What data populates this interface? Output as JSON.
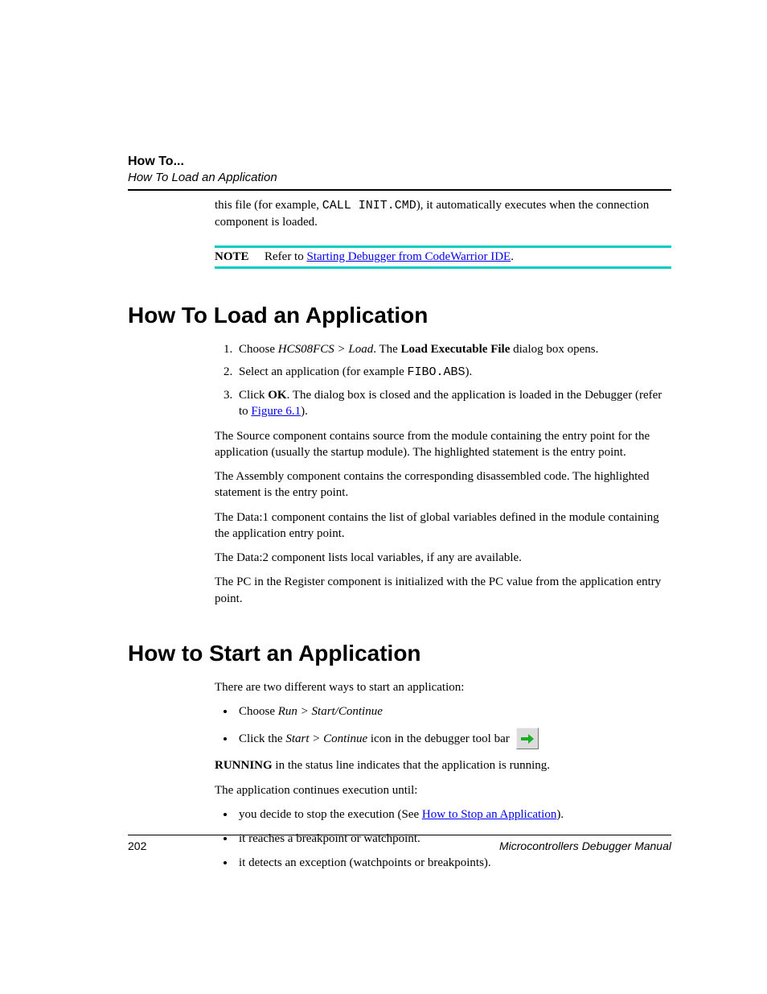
{
  "header": {
    "title": "How To...",
    "subtitle": "How To Load an Application"
  },
  "intro_para": {
    "prefix": "this file (for example, ",
    "code": "CALL INIT.CMD",
    "suffix": "), it automatically executes when the connection component is loaded."
  },
  "note": {
    "label": "NOTE",
    "prefix": "Refer to ",
    "link": "Starting Debugger from CodeWarrior IDE",
    "suffix": "."
  },
  "section1": {
    "heading": "How To Load an Application",
    "steps": [
      {
        "pre": "Choose ",
        "italic": "HCS08FCS > Load",
        "mid": ". The ",
        "bold": "Load Executable File",
        "post": " dialog box opens."
      },
      {
        "pre": "Select an application (for example ",
        "code": "FIBO.ABS",
        "post": ")."
      },
      {
        "pre": "Click ",
        "bold": "OK",
        "mid": ". The dialog box is closed and the application is loaded in the Debugger (refer to ",
        "link": "Figure 6.1",
        "post": ")."
      }
    ],
    "paragraphs": [
      "The Source component contains source from the module containing the entry point for the application (usually the startup module). The highlighted statement is the entry point.",
      "The Assembly component contains the corresponding disassembled code. The highlighted statement is the entry point.",
      "The Data:1 component contains the list of global variables defined in the module containing the application entry point.",
      "The Data:2 component lists local variables, if any are available.",
      "The PC in the Register component is initialized with the PC value from the application entry point."
    ]
  },
  "section2": {
    "heading": "How to Start an Application",
    "intro": "There are two different ways to start an application:",
    "bullets1": [
      {
        "pre": "Choose ",
        "italic": "Run > Start/Continue"
      },
      {
        "pre": "Click the ",
        "italic": "Start > Continue",
        "post": " icon in the debugger tool bar",
        "icon": true
      }
    ],
    "running_line": {
      "bold": "RUNNING",
      "rest": " in the status line indicates that the application is running."
    },
    "continue_intro": "The application continues execution until:",
    "bullets2": [
      {
        "pre": "you decide to stop the execution (See ",
        "link": "How to Stop an Application",
        "post": ")."
      },
      {
        "text": "it reaches a breakpoint or watchpoint."
      },
      {
        "text": "it detects an exception (watchpoints or breakpoints)."
      }
    ]
  },
  "footer": {
    "page": "202",
    "manual": "Microcontrollers Debugger Manual"
  }
}
